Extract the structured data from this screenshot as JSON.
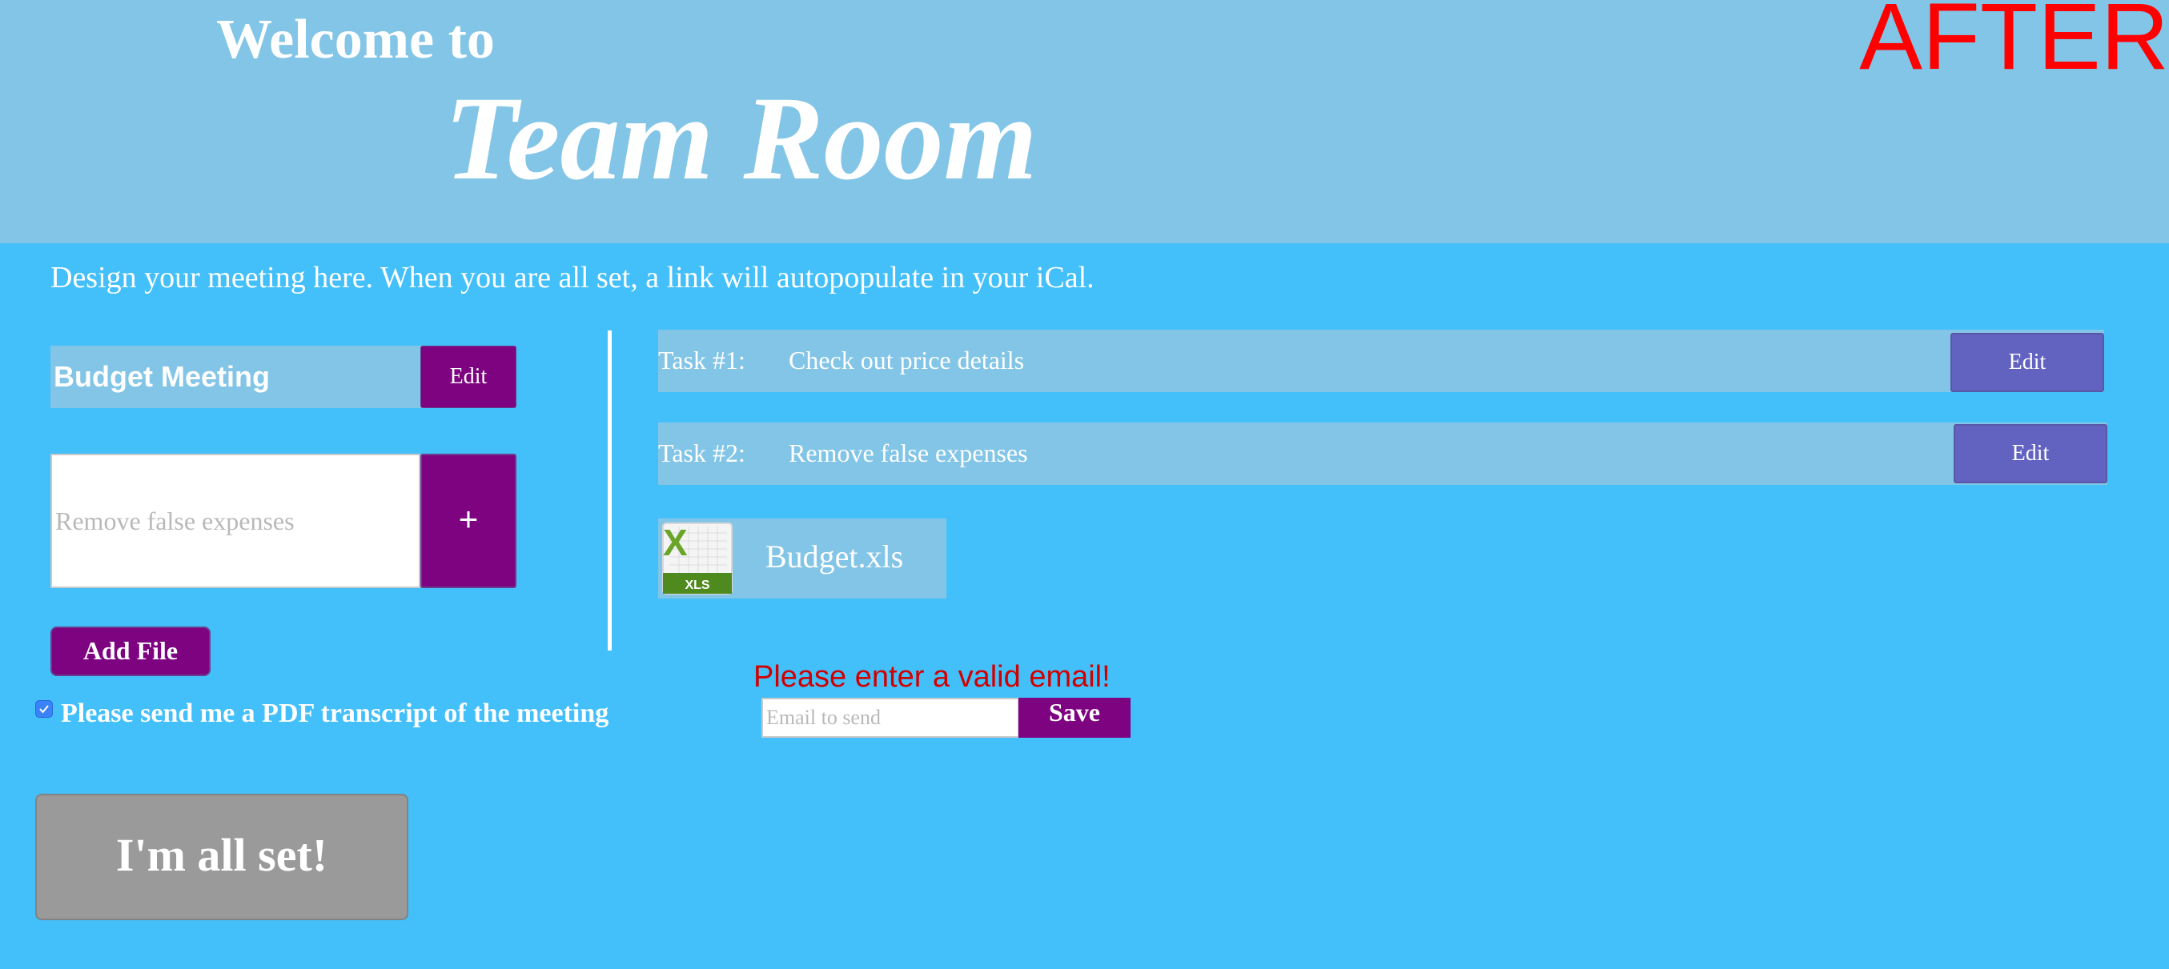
{
  "header": {
    "welcome": "Welcome to",
    "title": "Team Room",
    "stamp": "AFTER",
    "background_color": "#83c5e6",
    "stamp_color": "#ff0000"
  },
  "intro": "Design your meeting here. When  you are all set, a link will autopopulate in your iCal.",
  "meeting": {
    "title": "Budget Meeting",
    "edit_label": "Edit"
  },
  "task_input": {
    "value": "",
    "placeholder": "Remove false expenses",
    "add_label": "+"
  },
  "add_file_label": "Add File",
  "tasks": [
    {
      "number": "Task #1:",
      "text": "Check out price details",
      "edit_label": "Edit"
    },
    {
      "number": "Task #2:",
      "text": "Remove false expenses",
      "edit_label": "Edit"
    }
  ],
  "file": {
    "icon": "xls-file-icon",
    "icon_label": "XLS",
    "name": "Budget.xls"
  },
  "pdf_option": {
    "checked": true,
    "label": "Please send me a PDF transcript of the meeting"
  },
  "email": {
    "error": "Please enter a valid email!",
    "value": "",
    "placeholder": "Email to send",
    "save_label": "Save",
    "error_color": "#d10000"
  },
  "all_set_label": "I'm all set!",
  "colors": {
    "page_bg": "#43bffa",
    "panel_bg": "#83c5e6",
    "purple": "#7d0380",
    "task_edit": "#6262c0",
    "disabled": "#9a9a9a"
  }
}
